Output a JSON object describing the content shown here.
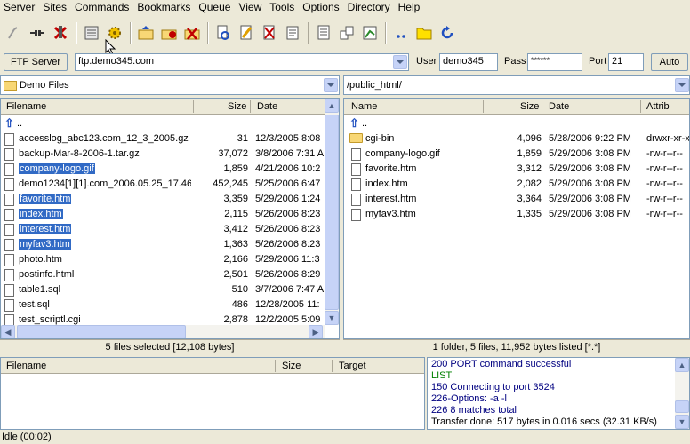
{
  "menu": [
    "Server",
    "Sites",
    "Commands",
    "Bookmarks",
    "Queue",
    "View",
    "Tools",
    "Options",
    "Directory",
    "Help"
  ],
  "connection": {
    "server_type_label": "FTP Server",
    "host": "ftp.demo345.com",
    "user_label": "User",
    "user": "demo345",
    "pass_label": "Pass",
    "pass": "******",
    "port_label": "Port",
    "port": "21",
    "auto_label": "Auto"
  },
  "local": {
    "path": "Demo Files",
    "headers": {
      "name": "Filename",
      "size": "Size",
      "date": "Date"
    },
    "parent": "..",
    "files": [
      {
        "name": "accesslog_abc123.com_12_3_2005.gz",
        "size": "31",
        "date": "12/3/2005 8:08",
        "selected": false
      },
      {
        "name": "backup-Mar-8-2006-1.tar.gz",
        "size": "37,072",
        "date": "3/8/2006 7:31 A",
        "selected": false
      },
      {
        "name": "company-logo.gif",
        "size": "1,859",
        "date": "4/21/2006 10:2",
        "selected": true
      },
      {
        "name": "demo1234[1][1].com_2006.05.25_17.46",
        "size": "452,245",
        "date": "5/25/2006 6:47",
        "selected": false
      },
      {
        "name": "favorite.htm",
        "size": "3,359",
        "date": "5/29/2006 1:24",
        "selected": true
      },
      {
        "name": "index.htm",
        "size": "2,115",
        "date": "5/26/2006 8:23",
        "selected": true
      },
      {
        "name": "interest.htm",
        "size": "3,412",
        "date": "5/26/2006 8:23",
        "selected": true
      },
      {
        "name": "myfav3.htm",
        "size": "1,363",
        "date": "5/26/2006 8:23",
        "selected": true
      },
      {
        "name": "photo.htm",
        "size": "2,166",
        "date": "5/29/2006 11:3",
        "selected": false
      },
      {
        "name": "postinfo.html",
        "size": "2,501",
        "date": "5/26/2006 8:29",
        "selected": false
      },
      {
        "name": "table1.sql",
        "size": "510",
        "date": "3/7/2006 7:47 A",
        "selected": false
      },
      {
        "name": "test.sql",
        "size": "486",
        "date": "12/28/2005 11:",
        "selected": false
      },
      {
        "name": "test_scriptl.cgi",
        "size": "2,878",
        "date": "12/2/2005 5:09",
        "selected": false
      }
    ],
    "status": "5 files selected [12,108 bytes]"
  },
  "remote": {
    "path": "/public_html/",
    "headers": {
      "name": "Name",
      "size": "Size",
      "date": "Date",
      "attrib": "Attrib"
    },
    "parent": "..",
    "files": [
      {
        "name": "cgi-bin",
        "size": "4,096",
        "date": "5/28/2006 9:22 PM",
        "attrib": "drwxr-xr-x",
        "folder": true
      },
      {
        "name": "company-logo.gif",
        "size": "1,859",
        "date": "5/29/2006 3:08 PM",
        "attrib": "-rw-r--r--",
        "folder": false
      },
      {
        "name": "favorite.htm",
        "size": "3,312",
        "date": "5/29/2006 3:08 PM",
        "attrib": "-rw-r--r--",
        "folder": false
      },
      {
        "name": "index.htm",
        "size": "2,082",
        "date": "5/29/2006 3:08 PM",
        "attrib": "-rw-r--r--",
        "folder": false
      },
      {
        "name": "interest.htm",
        "size": "3,364",
        "date": "5/29/2006 3:08 PM",
        "attrib": "-rw-r--r--",
        "folder": false
      },
      {
        "name": "myfav3.htm",
        "size": "1,335",
        "date": "5/29/2006 3:08 PM",
        "attrib": "-rw-r--r--",
        "folder": false
      }
    ],
    "status": "1 folder, 5 files, 11,952 bytes listed [*.*]"
  },
  "queue": {
    "headers": {
      "name": "Filename",
      "size": "Size",
      "target": "Target"
    }
  },
  "log": [
    {
      "text": "200 PORT command successful",
      "color": "#000080"
    },
    {
      "text": "LIST",
      "color": "#008000"
    },
    {
      "text": "150 Connecting to port 3524",
      "color": "#000080"
    },
    {
      "text": "226-Options: -a -l",
      "color": "#000080"
    },
    {
      "text": "226 8 matches total",
      "color": "#000080"
    },
    {
      "text": "Transfer done: 517 bytes in 0.016 secs (32.31 KB/s)",
      "color": "#000000"
    }
  ],
  "statusbar": "Idle (00:02)"
}
